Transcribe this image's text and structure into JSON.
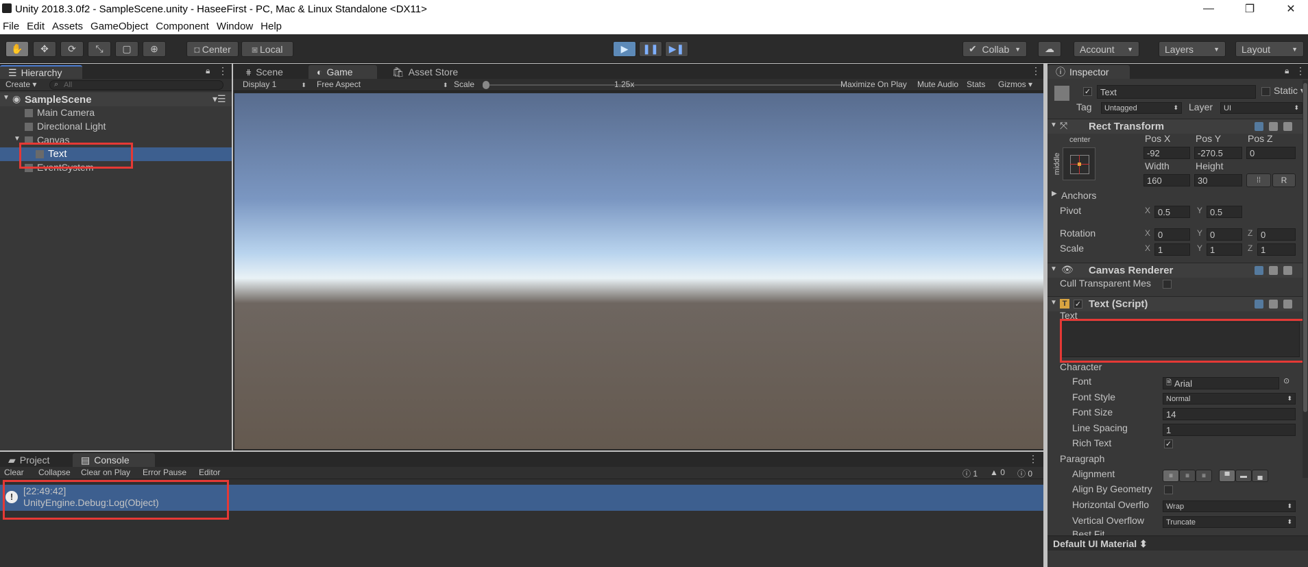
{
  "window": {
    "title": "Unity 2018.3.0f2 - SampleScene.unity - HaseeFirst - PC, Mac & Linux Standalone <DX11>",
    "min": "—",
    "max": "❐",
    "close": "✕"
  },
  "menu": [
    "File",
    "Edit",
    "Assets",
    "GameObject",
    "Component",
    "Window",
    "Help"
  ],
  "toolbar": {
    "pivot": "Center",
    "space": "Local",
    "collab": "Collab",
    "account": "Account",
    "layers": "Layers",
    "layout": "Layout"
  },
  "hierarchy": {
    "tab": "Hierarchy",
    "create": "Create",
    "search_placeholder": "All",
    "scene": "SampleScene",
    "items": [
      "Main Camera",
      "Directional Light",
      "Canvas",
      "Text",
      "EventSystem"
    ]
  },
  "center": {
    "tabs": [
      "Scene",
      "Game",
      "Asset Store"
    ],
    "display": "Display 1",
    "aspect": "Free Aspect",
    "scale_label": "Scale",
    "scale_value": "1.25x",
    "options": [
      "Maximize On Play",
      "Mute Audio",
      "Stats",
      "Gizmos"
    ]
  },
  "bottom": {
    "tabs": [
      "Project",
      "Console"
    ],
    "buttons": [
      "Clear",
      "Collapse",
      "Clear on Play",
      "Error Pause",
      "Editor"
    ],
    "counts": [
      "1",
      "0",
      "0"
    ],
    "log": {
      "time": "[22:49:42]",
      "message": "UnityEngine.Debug:Log(Object)"
    }
  },
  "inspector": {
    "tab": "Inspector",
    "object_name": "Text",
    "static": "Static",
    "tag_label": "Tag",
    "tag_value": "Untagged",
    "layer_label": "Layer",
    "layer_value": "UI",
    "rect": {
      "title": "Rect Transform",
      "anchor_top": "center",
      "anchor_side": "middle",
      "posx_label": "Pos X",
      "posy_label": "Pos Y",
      "posz_label": "Pos Z",
      "posx": "-92",
      "posy": "-270.5",
      "posz": "0",
      "width_label": "Width",
      "height_label": "Height",
      "width": "160",
      "height": "30",
      "r_button": "R",
      "anchors": "Anchors",
      "pivot": "Pivot",
      "pivot_x": "0.5",
      "pivot_y": "0.5",
      "rotation": "Rotation",
      "rot_x": "0",
      "rot_y": "0",
      "rot_z": "0",
      "scale": "Scale",
      "scale_x": "1",
      "scale_y": "1",
      "scale_z": "1",
      "x": "X",
      "y": "Y",
      "z": "Z"
    },
    "canvas_renderer": {
      "title": "Canvas Renderer",
      "cull": "Cull Transparent Mes"
    },
    "text_script": {
      "title": "Text (Script)",
      "text_label": "Text",
      "character": "Character",
      "font_label": "Font",
      "font_value": "Arial",
      "font_style_label": "Font Style",
      "font_style_value": "Normal",
      "font_size_label": "Font Size",
      "font_size_value": "14",
      "line_spacing_label": "Line Spacing",
      "line_spacing_value": "1",
      "rich_text_label": "Rich Text",
      "paragraph": "Paragraph",
      "alignment_label": "Alignment",
      "align_geometry_label": "Align By Geometry",
      "h_overflow_label": "Horizontal Overflo",
      "h_overflow_value": "Wrap",
      "v_overflow_label": "Vertical Overflow",
      "v_overflow_value": "Truncate",
      "best_fit_label": "Best Fit"
    },
    "material": "Default UI Material"
  },
  "colors": {
    "accent": "#5d8ab8",
    "highlight": "#3d5f8f",
    "annotation": "#e53935"
  }
}
